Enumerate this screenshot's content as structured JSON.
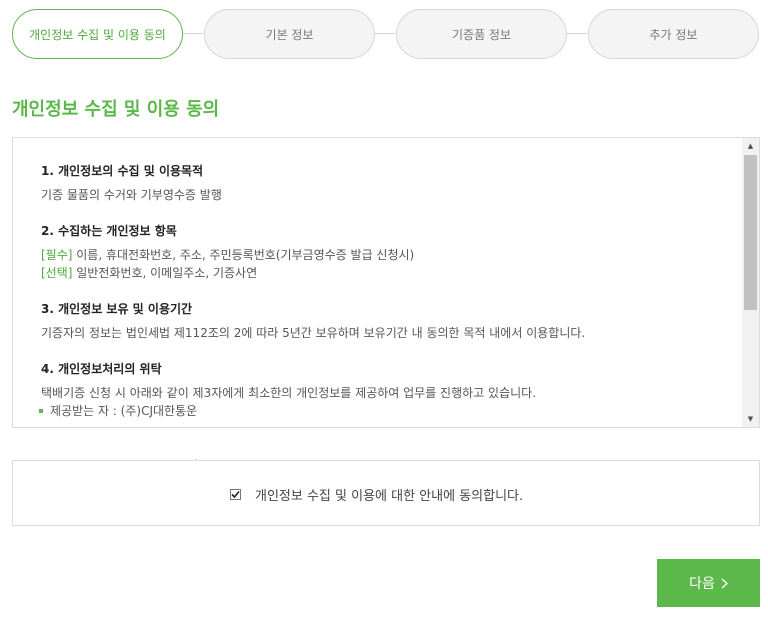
{
  "steps": [
    {
      "label": "개인정보 수집 및 이용 동의",
      "active": true
    },
    {
      "label": "기본 정보",
      "active": false
    },
    {
      "label": "기증품 정보",
      "active": false
    },
    {
      "label": "추가 정보",
      "active": false
    }
  ],
  "section_title": "개인정보 수집 및 이용 동의",
  "terms": {
    "s1_head": "1. 개인정보의 수집 및 이용목적",
    "s1_text": "기증 물품의 수거와 기부영수증 발행",
    "s2_head": "2. 수집하는 개인정보 항목",
    "s2_req_tag": "[필수]",
    "s2_req_text": " 이름, 휴대전화번호, 주소, 주민등록번호(기부금영수증 발급 신청시)",
    "s2_opt_tag": "[선택]",
    "s2_opt_text": " 일반전화번호, 이메일주소, 기증사연",
    "s3_head": "3. 개인정보 보유 및 이용기간",
    "s3_text": "기증자의 정보는 법인세법 제112조의 2에 따라 5년간 보유하며 보유기간 내 동의한 목적 내에서 이용합니다.",
    "s4_head": "4. 개인정보처리의 위탁",
    "s4_text": "택배기증 신청 시 아래와 같이 제3자에게 최소한의 개인정보를 제공하여 업무를 진행하고 있습니다.",
    "s4_bullet": "제공받는 자 : (주)CJ대한통운"
  },
  "agreement": {
    "label": "개인정보 수집 및 이용에 대한 안내에 동의합니다.",
    "checked": true
  },
  "next_button": {
    "label": "다음",
    "icon": "chevron-right-icon"
  },
  "colors": {
    "accent": "#5cb84a",
    "arrow": "#3aaee8"
  }
}
